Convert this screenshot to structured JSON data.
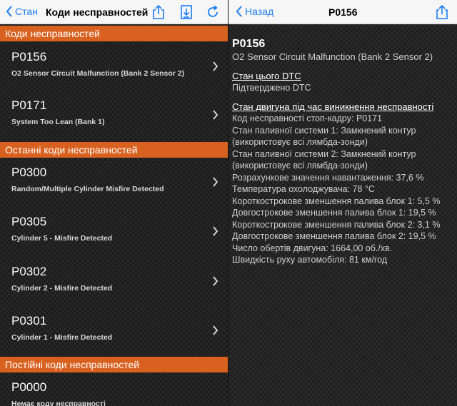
{
  "left_nav": {
    "back_label": "Стан",
    "title": "Коди несправностей",
    "icons": [
      "share-icon",
      "save-icon",
      "refresh-icon"
    ]
  },
  "right_nav": {
    "back_label": "Назад",
    "title": "P0156",
    "icons": [
      "share-icon"
    ]
  },
  "sections": [
    {
      "title": "Коди несправностей",
      "items": [
        {
          "code": "P0156",
          "description": "O2 Sensor Circuit Malfunction (Bank 2 Sensor 2)"
        },
        {
          "code": "P0171",
          "description": "System Too Lean (Bank 1)"
        }
      ]
    },
    {
      "title": "Останні коди несправностей",
      "items": [
        {
          "code": "P0300",
          "description": "Random/Multiple Cylinder Misfire Detected"
        },
        {
          "code": "P0305",
          "description": "Cylinder 5 - Misfire Detected"
        },
        {
          "code": "P0302",
          "description": "Cylinder 2 - Misfire Detected"
        },
        {
          "code": "P0301",
          "description": "Cylinder 1 - Misfire Detected"
        }
      ]
    },
    {
      "title": "Постійні коди несправностей",
      "items": [
        {
          "code": "P0000",
          "description": "Немає коду несправності"
        }
      ]
    }
  ],
  "detail": {
    "code": "P0156",
    "name": "O2 Sensor Circuit Malfunction (Bank 2 Sensor 2)",
    "dtc_status_heading": "Стан цього DTC",
    "dtc_status_value": "Підтверджено DTC",
    "freeze_heading": "Стан двигуна під час виникнення несправності",
    "freeze_lines": [
      "Код несправності стоп-кадру: P0171",
      "Стан паливної системи 1: Замкнений контур (використовує всі лямбда-зонди)",
      "Стан паливної системи 2: Замкнений контур (використовує всі лямбда-зонди)",
      "Розрахункове значення навантаження: 37,6 %",
      "Температура охолоджувача: 78 °C",
      "Короткострокове зменшення палива блок 1: 5,5 %",
      "Довгострокове зменшення палива блок 1: 19,5 %",
      "Короткострокове зменшення палива блок 2: 3,1 %",
      "Довгострокове зменшення палива блок 2: 19,5 %",
      "Число обертів двигуна: 1664,00 об./хв.",
      "Швидкість руху автомобіля: 81 км/год"
    ]
  },
  "colors": {
    "section_header": "#d9611f",
    "ios_blue": "#1a7cf5"
  }
}
